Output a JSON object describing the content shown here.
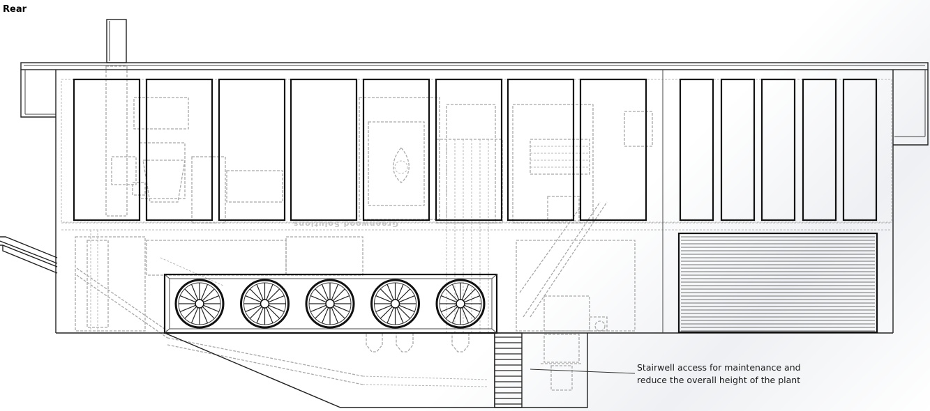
{
  "view_label": "Rear",
  "callout": {
    "lines": [
      "Stairwell access for maintenance and",
      "reduce the overall height of the plant"
    ]
  },
  "watermark_logo": "Greenwood Solutions",
  "fans": {
    "count": 5
  },
  "upper_panels": {
    "left_group_count": 8,
    "right_group_count": 5
  },
  "colors": {
    "line": "#222222",
    "hidden_line": "#a8a8a8",
    "background": "#ffffff"
  }
}
